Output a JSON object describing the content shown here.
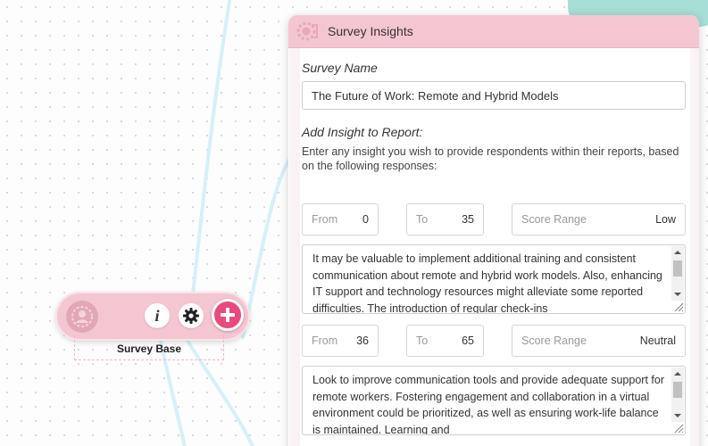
{
  "node": {
    "label": "Survey Base",
    "info_glyph": "i",
    "icons": [
      "user-circle-icon",
      "info-icon",
      "gear-icon",
      "plus-icon"
    ]
  },
  "panel": {
    "title": "Survey Insights",
    "survey_name_label": "Survey Name",
    "survey_name_value": "The Future of Work: Remote and Hybrid Models",
    "add_insight_label": "Add Insight to Report:",
    "add_insight_help": "Enter any insight you wish to provide respondents within their reports, based on the following responses:",
    "insights": [
      {
        "from_label": "From",
        "from_value": "0",
        "to_label": "To",
        "to_value": "35",
        "score_label": "Score Range",
        "score_value": "Low",
        "text": "It may be valuable to implement additional training and consistent communication about remote and hybrid work models. Also, enhancing IT support and technology resources might alleviate some reported difficulties. The introduction of regular check-ins"
      },
      {
        "from_label": "From",
        "from_value": "36",
        "to_label": "To",
        "to_value": "65",
        "score_label": "Score Range",
        "score_value": "Neutral",
        "text": "Look to improve communication tools and provide adequate support for remote workers. Fostering engagement and collaboration in a virtual environment could be prioritized, as well as ensuring work-life balance is maintained. Learning and"
      }
    ]
  },
  "colors": {
    "node_pink": "#f4c6d2",
    "add_button": "#e94a7d",
    "connector": "#d6f0f8",
    "teal_card": "#a6ddd4"
  }
}
